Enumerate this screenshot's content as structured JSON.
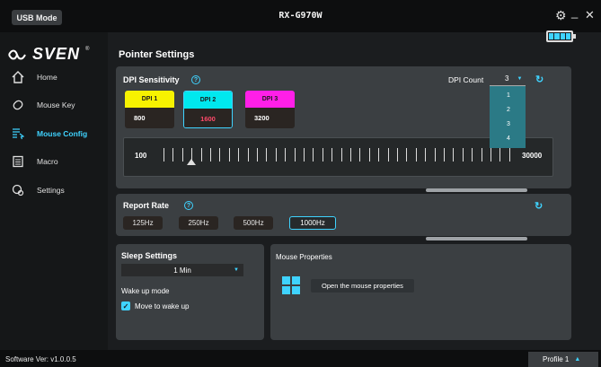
{
  "titlebar": {
    "mode_button": "USB Mode",
    "model": "RX-G970W",
    "settings_icon": "gear-icon",
    "minimize_label": "_",
    "close_label": "✕"
  },
  "sidebar": {
    "logo_text": "SVEN",
    "logo_mark": "®",
    "items": [
      {
        "label": "Home",
        "icon": "home-icon"
      },
      {
        "label": "Mouse Key",
        "icon": "mouse-icon"
      },
      {
        "label": "Mouse Config",
        "icon": "mouse-config-icon",
        "active": true
      },
      {
        "label": "Macro",
        "icon": "macro-icon"
      },
      {
        "label": "Settings",
        "icon": "settings-icon"
      }
    ]
  },
  "main": {
    "title": "Pointer Settings",
    "battery_level": "4/4"
  },
  "dpi": {
    "title": "DPI Sensitivity",
    "help": "?",
    "count_label": "DPI Count",
    "count_value": "3",
    "count_options": [
      "1",
      "2",
      "3",
      "4"
    ],
    "levels": [
      {
        "name": "DPI 1",
        "value": "800",
        "color": "#f7f200"
      },
      {
        "name": "DPI 2",
        "value": "1600",
        "color": "#00e8ee"
      },
      {
        "name": "DPI 3",
        "value": "3200",
        "color": "#ff1fe8"
      }
    ],
    "slider_min": "100",
    "slider_max": "30000"
  },
  "report_rate": {
    "title": "Report Rate",
    "help": "?",
    "options": [
      "125Hz",
      "250Hz",
      "500Hz",
      "1000Hz"
    ],
    "selected": "1000Hz"
  },
  "sleep": {
    "title": "Sleep Settings",
    "value": "1 Min",
    "wake_label": "Wake up mode",
    "checkbox_label": "Move to wake up",
    "checkbox_checked": true
  },
  "mouse_properties": {
    "title": "Mouse Properties",
    "button_label": "Open the mouse properties"
  },
  "footer": {
    "version": "Software Ver: v1.0.0.5",
    "profile": "Profile 1"
  },
  "colors": {
    "accent": "#3fd3ff",
    "panel": "#3b3f42",
    "background": "#1b1d1f"
  }
}
